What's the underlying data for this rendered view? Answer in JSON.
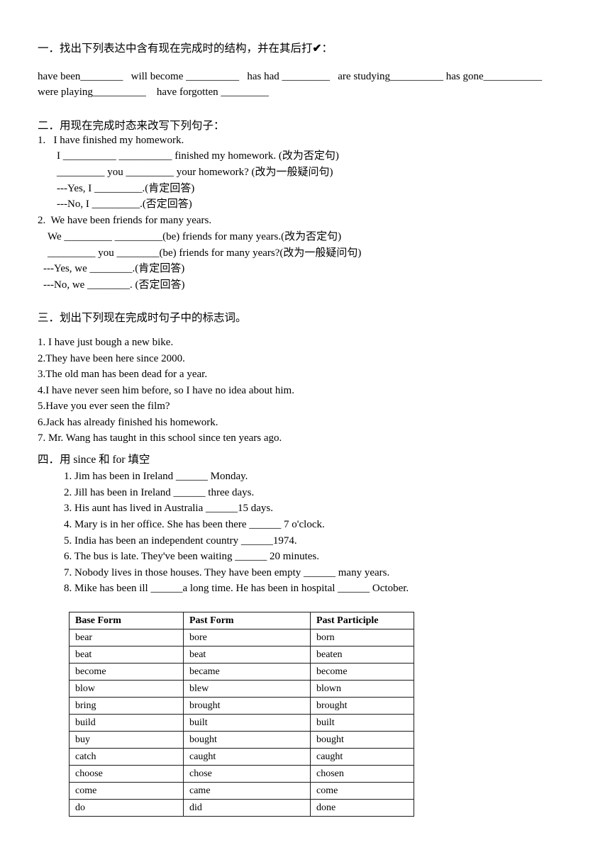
{
  "document": {
    "sections": [
      {
        "id": "section-1",
        "heading": "一．找出下列表达中含有现在完成时的结构，并在其后打",
        "heading_check": "✔",
        "heading_colon": "：",
        "lines": [
          "have been________   will become __________   has had _________   are studying__________ has gone___________",
          "were playing__________    have forgotten _________"
        ]
      },
      {
        "id": "section-2",
        "heading": "二．用现在完成时态来改写下列句子：",
        "lines": [
          "1.   I have finished my homework.",
          "I __________ __________ finished my homework. (改为否定句)",
          "_________ you _________ your homework? (改为一般疑问句)",
          "---Yes, I _________.(肯定回答)",
          "---No, I _________.(否定回答)",
          "2.  We have been friends for many years.",
          "We _________ _________(be) friends for many years.(改为否定句)",
          "_________ you ________(be) friends for many years?(改为一般疑问句)",
          "---Yes, we ________.(肯定回答)",
          "---No, we ________. (否定回答)"
        ]
      },
      {
        "id": "section-3",
        "heading": "三．划出下列现在完成时句子中的标志词。",
        "lines": [
          "1. I have just bough a new bike.",
          "2.They have been here since 2000.",
          "3.The old man has been dead for a year.",
          "4.I have never seen him before, so I have no idea about him.",
          "5.Have you ever seen the film?",
          "6.Jack has already finished his homework.",
          "7. Mr. Wang has taught in this school since ten years ago."
        ]
      },
      {
        "id": "section-4",
        "heading": "四．用 since 和 for 填空",
        "lines": [
          "1. Jim has been in Ireland ______ Monday.",
          "2. Jill has been in Ireland ______ three days.",
          "3. His aunt has lived in Australia ______15 days.",
          "4. Mary is in her office. She has been there ______ 7 o'clock.",
          "5. India has been an independent country ______1974.",
          "6. The bus is late. They've been waiting ______ 20 minutes.",
          "7. Nobody lives in those houses. They have been empty ______ many years.",
          "8. Mike has been ill ______a long time. He has been in hospital ______ October."
        ]
      }
    ],
    "verb_table": {
      "headers": [
        "Base Form",
        "Past Form",
        "Past Participle"
      ],
      "rows": [
        [
          "bear",
          "bore",
          "born"
        ],
        [
          "beat",
          "beat",
          "beaten"
        ],
        [
          "become",
          "became",
          "become"
        ],
        [
          "blow",
          "blew",
          "blown"
        ],
        [
          "bring",
          "brought",
          "brought"
        ],
        [
          "build",
          "built",
          "built"
        ],
        [
          "buy",
          "bought",
          "bought"
        ],
        [
          "catch",
          "caught",
          "caught"
        ],
        [
          "choose",
          "chose",
          "chosen"
        ],
        [
          "come",
          "came",
          "come"
        ],
        [
          "do",
          "did",
          "done"
        ]
      ]
    }
  }
}
